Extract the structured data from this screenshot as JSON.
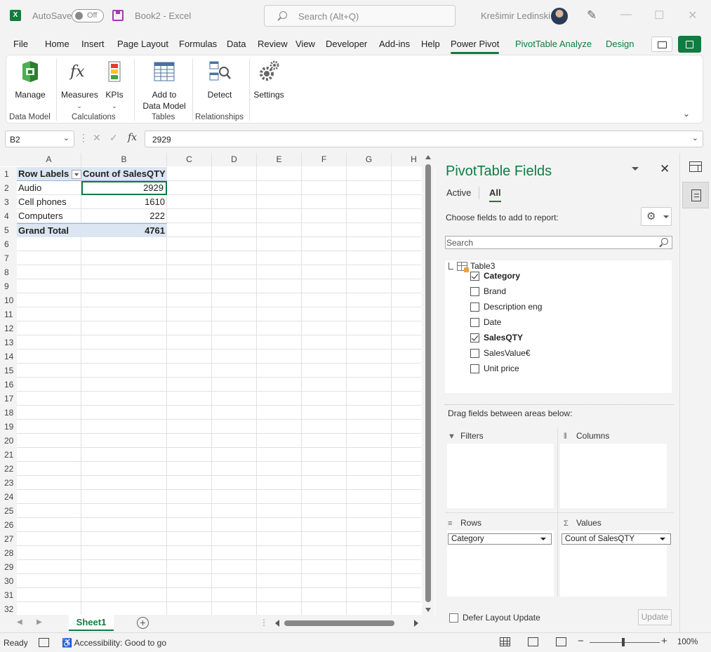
{
  "titlebar": {
    "autosave_label": "AutoSave",
    "autosave_state": "Off",
    "doc_title": "Book2  -  Excel",
    "search_placeholder": "Search (Alt+Q)",
    "user_name": "Krešimir Ledinski",
    "app_logo": "X"
  },
  "menu": {
    "items": [
      "File",
      "Home",
      "Insert",
      "Page Layout",
      "Formulas",
      "Data",
      "Review",
      "View",
      "Developer",
      "Add-ins",
      "Help",
      "Power Pivot",
      "PivotTable Analyze",
      "Design"
    ],
    "active": "Power Pivot"
  },
  "ribbon": {
    "manage": "Manage",
    "measures": "Measures",
    "kpis": "KPIs",
    "add_to": "Add to",
    "data_model": "Data Model",
    "detect": "Detect",
    "settings": "Settings",
    "groups": [
      "Data Model",
      "Calculations",
      "Tables",
      "Relationships"
    ]
  },
  "formula_bar": {
    "name_box": "B2",
    "fx": "fx",
    "value": "2929"
  },
  "grid": {
    "columns": [
      "A",
      "B",
      "C",
      "D",
      "E",
      "F",
      "G",
      "H"
    ],
    "rows": [
      "1",
      "2",
      "3",
      "4",
      "5",
      "6",
      "7",
      "8",
      "9",
      "10",
      "11",
      "12",
      "13",
      "14",
      "15",
      "16",
      "17",
      "18",
      "19",
      "20",
      "21",
      "22",
      "23",
      "24",
      "25",
      "26",
      "27",
      "28",
      "29",
      "30",
      "31",
      "32"
    ],
    "pivot": {
      "header_a": "Row Labels",
      "header_b": "Count of SalesQTY",
      "data": [
        {
          "label": "Audio",
          "value": "2929"
        },
        {
          "label": "Cell phones",
          "value": "1610"
        },
        {
          "label": "Computers",
          "value": "222"
        }
      ],
      "total_label": "Grand Total",
      "total_value": "4761"
    }
  },
  "sheets": {
    "active": "Sheet1",
    "add": "+"
  },
  "pivot_pane": {
    "title": "PivotTable Fields",
    "tab_active": "Active",
    "tab_all": "All",
    "choose_label": "Choose fields to add to report:",
    "search_placeholder": "Search",
    "table_name": "Table3",
    "fields": [
      {
        "name": "Category",
        "checked": true
      },
      {
        "name": "Brand",
        "checked": false
      },
      {
        "name": "Description eng",
        "checked": false
      },
      {
        "name": "Date",
        "checked": false
      },
      {
        "name": "SalesQTY",
        "checked": true
      },
      {
        "name": "SalesValue€",
        "checked": false
      },
      {
        "name": "Unit price",
        "checked": false
      }
    ],
    "drag_label": "Drag fields between areas below:",
    "areas": {
      "filters": "Filters",
      "columns": "Columns",
      "rows": "Rows",
      "values": "Values",
      "rows_field": "Category",
      "values_field": "Count of SalesQTY"
    },
    "defer_label": "Defer Layout Update",
    "update_label": "Update"
  },
  "status": {
    "ready": "Ready",
    "accessibility": "Accessibility: Good to go",
    "zoom": "100%"
  },
  "colors": {
    "excel_green": "#107c41",
    "pivot_header": "#dce6f2"
  }
}
